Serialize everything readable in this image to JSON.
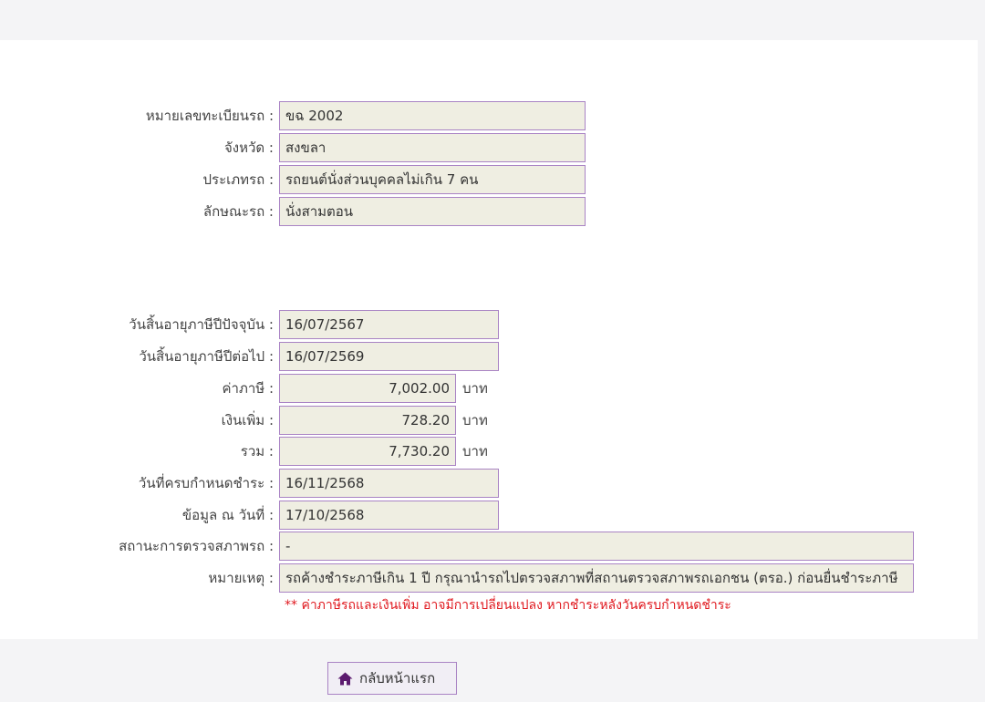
{
  "vehicle": {
    "plate_label": "หมายเลขทะเบียนรถ :",
    "plate_value": "ขฉ 2002",
    "province_label": "จังหวัด :",
    "province_value": "สงขลา",
    "type_label": "ประเภทรถ :",
    "type_value": "รถยนต์นั่งส่วนบุคคลไม่เกิน 7 คน",
    "style_label": "ลักษณะรถ :",
    "style_value": "นั่งสามตอน"
  },
  "tax": {
    "current_expiry_label": "วันสิ้นอายุภาษีปีปัจจุบัน :",
    "current_expiry_value": "16/07/2567",
    "next_expiry_label": "วันสิ้นอายุภาษีปีต่อไป :",
    "next_expiry_value": "16/07/2569",
    "tax_label": "ค่าภาษี :",
    "tax_value": "7,002.00",
    "surcharge_label": "เงินเพิ่ม :",
    "surcharge_value": "728.20",
    "total_label": "รวม :",
    "total_value": "7,730.20",
    "unit": "บาท",
    "due_label": "วันที่ครบกำหนดชำระ :",
    "due_value": "16/11/2568",
    "asof_label": "ข้อมูล ณ วันที่ :",
    "asof_value": "17/10/2568",
    "inspection_label": "สถานะการตรวจสภาพรถ :",
    "inspection_value": "-",
    "remark_label": "หมายเหตุ :",
    "remark_value": "รถค้างชำระภาษีเกิน 1 ปี กรุณานำรถไปตรวจสภาพที่สถานตรวจสภาพรถเอกชน (ตรอ.) ก่อนยื่นชำระภาษี"
  },
  "warning_note": "** ค่าภาษีรถและเงินเพิ่ม อาจมีการเปลี่ยนแปลง หากชำระหลังวันครบกำหนดชำระ",
  "home_button": {
    "label": "กลับหน้าแรก",
    "icon": "home-icon"
  },
  "colors": {
    "field_bg": "#efeee2",
    "field_border": "#a983c4",
    "warning": "#e0191f",
    "icon": "#5b1a6e"
  }
}
